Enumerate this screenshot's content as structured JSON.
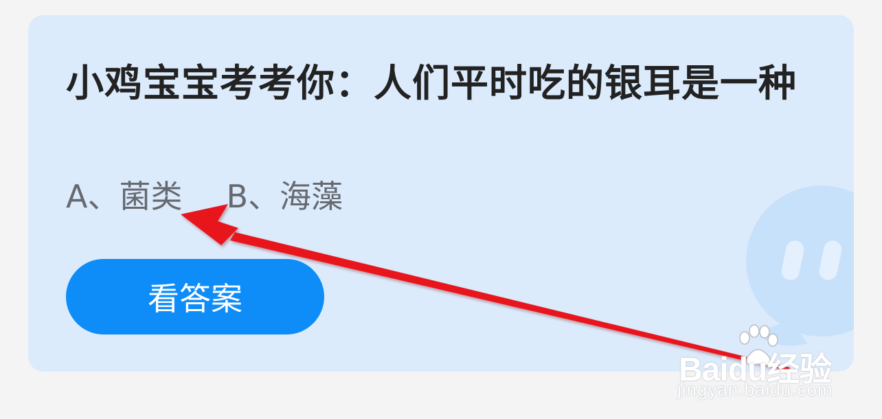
{
  "quiz": {
    "question": "小鸡宝宝考考你：人们平时吃的银耳是一种",
    "options": [
      {
        "text": "A、菌类"
      },
      {
        "text": "B、海藻"
      }
    ],
    "answer_button_label": "看答案"
  },
  "watermark": {
    "logo_text": "Baidu经验",
    "url": "jingyan.baidu.com"
  },
  "colors": {
    "card_background": "#dcebfc",
    "button": "#0e8cf8",
    "annotation_arrow": "#e8141c"
  },
  "icons": [
    "mascot-bubble-icon",
    "baidu-paw-icon",
    "annotation-arrow"
  ]
}
